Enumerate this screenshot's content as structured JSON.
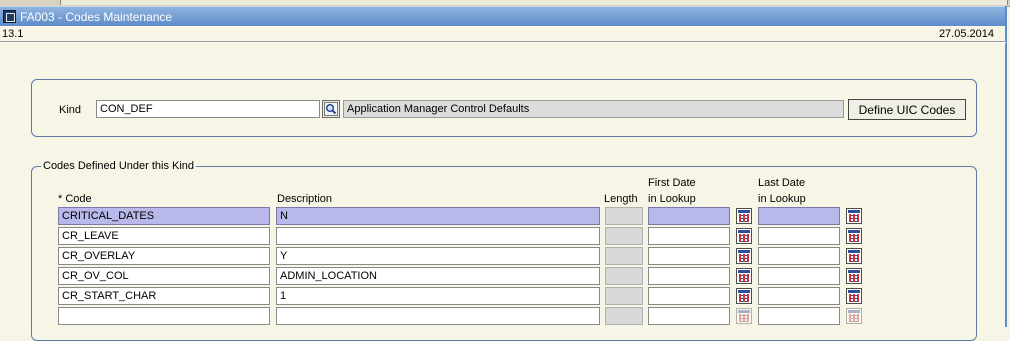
{
  "window": {
    "title": "FA003 - Codes Maintenance",
    "version": "13.1",
    "date": "27.05.2014"
  },
  "kind": {
    "label": "Kind",
    "value": "CON_DEF",
    "description": "Application Manager Control Defaults",
    "define_button": "Define UIC Codes"
  },
  "codes": {
    "section_title": "Codes Defined Under this Kind",
    "headers": {
      "code": "* Code",
      "description": "Description",
      "length": "Length",
      "first_date_1": "First Date",
      "first_date_2": "in Lookup",
      "last_date_1": "Last Date",
      "last_date_2": "in Lookup"
    },
    "rows": [
      {
        "code": "CRITICAL_DATES",
        "description": "N",
        "length": "",
        "first_date": "",
        "last_date": "",
        "selected": true
      },
      {
        "code": "CR_LEAVE",
        "description": "",
        "length": "",
        "first_date": "",
        "last_date": ""
      },
      {
        "code": "CR_OVERLAY",
        "description": "Y",
        "length": "",
        "first_date": "",
        "last_date": ""
      },
      {
        "code": "CR_OV_COL",
        "description": "ADMIN_LOCATION",
        "length": "",
        "first_date": "",
        "last_date": ""
      },
      {
        "code": "CR_START_CHAR",
        "description": "1",
        "length": "",
        "first_date": "",
        "last_date": ""
      },
      {
        "code": "",
        "description": "",
        "length": "",
        "first_date": "",
        "last_date": ""
      }
    ]
  },
  "icons": {
    "title": "app-window-icon",
    "lov": "search-lov-icon",
    "calendar": "calendar-icon"
  },
  "colors": {
    "titlebar": "#5d8cc9",
    "background": "#f7f5e6",
    "selected_row": "#b8b8ea",
    "panel_border": "#5b7aa6"
  }
}
